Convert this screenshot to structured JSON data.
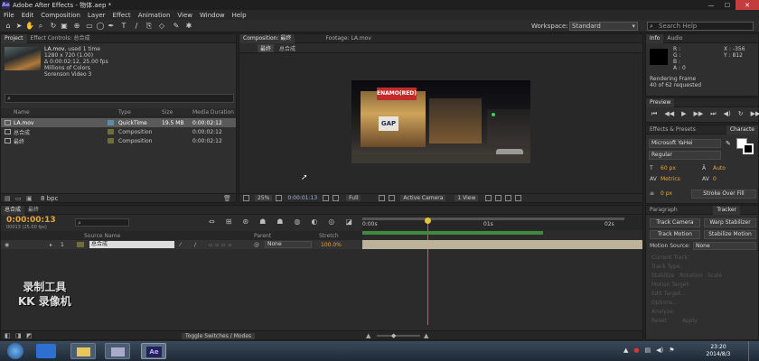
{
  "window": {
    "title": "Adobe After Effects - 物体.aep *",
    "minimize": "—",
    "maximize": "☐",
    "close": "✕"
  },
  "menu": [
    "File",
    "Edit",
    "Composition",
    "Layer",
    "Effect",
    "Animation",
    "View",
    "Window",
    "Help"
  ],
  "toolbar": {
    "workspace_label": "Workspace:",
    "workspace_value": "Standard",
    "search_placeholder": "Search Help"
  },
  "project": {
    "tab": "Project",
    "tab2": "Effect Controls: 总合成",
    "footage_name": "LA.mov",
    "footage_used": ", used 1 time",
    "footage_info": [
      "1280 x 720 (1.00)",
      "Δ 0:00:02:12, 25.00 fps",
      "Millions of Colors",
      "Sorenson Video 3"
    ],
    "columns": [
      "Name",
      "Type",
      "Size",
      "Media Duration"
    ],
    "items": [
      {
        "name": "LA.mov",
        "type": "QuickTime",
        "size": "19.5 MB",
        "duration": "0:00:02:12",
        "color": "#5d8ca8",
        "selected": true
      },
      {
        "name": "总合成",
        "type": "Composition",
        "size": "",
        "duration": "0:00:02:12",
        "color": "#6e6e3a",
        "selected": false
      },
      {
        "name": "最终",
        "type": "Composition",
        "size": "",
        "duration": "0:00:02:12",
        "color": "#6e6e3a",
        "selected": false
      }
    ],
    "bpc": "8 bpc"
  },
  "viewer": {
    "tab": "Composition: 最终",
    "tab2": "Footage: LA.mov",
    "crumbs": [
      "最终",
      "总合成"
    ],
    "zoom": "25%",
    "time": "0:00:01:13",
    "resolution": "Full",
    "camera": "Active Camera",
    "views": "1 View",
    "sign_text": "ENAMO(RED)",
    "store_text": "GAP"
  },
  "info": {
    "tab": "Info",
    "tab2": "Audio",
    "r": "R :",
    "g": "G :",
    "b": "B :",
    "a": "A : 0",
    "x": "X : -356",
    "y": "Y : 812",
    "render1": "Rendering Frame",
    "render2": "40 of 62 requested"
  },
  "preview": {
    "tab": "Preview"
  },
  "effects": {
    "tab": "Effects & Presets",
    "tab2": "Characte"
  },
  "character": {
    "font": "Microsoft YaHei",
    "style": "Regular",
    "size": "60 px",
    "leading": "Auto",
    "kerning": "Metrics",
    "tracking": "0",
    "stroke_size": "0 px",
    "stroke_mode": "Stroke Over Fill"
  },
  "tracker": {
    "tab": "Paragraph",
    "tab2": "Tracker",
    "buttons": [
      "Track Camera",
      "Warp Stabilizer",
      "Track Motion",
      "Stabilize Motion"
    ],
    "source_label": "Motion Source:",
    "source_value": "None",
    "dim": [
      "Current Track:",
      "Track Type:",
      "Stabilize",
      "Rotation",
      "Scale",
      "Motion Target:",
      "Edit Target...",
      "Options...",
      "Analyze:",
      "Reset",
      "Apply"
    ]
  },
  "timeline": {
    "tabs": [
      "总合成",
      "最终"
    ],
    "timecode": "0:00:00:13",
    "fps": "00013 (25.00 fps)",
    "cols": {
      "source": "Source Name",
      "parent": "Parent",
      "stretch": "Stretch"
    },
    "layer": {
      "num": "1",
      "name": "总合成",
      "parent": "None",
      "stretch": "100.0%"
    },
    "ruler": [
      "0:00s",
      "01s",
      "02s"
    ],
    "toggle": "Toggle Switches / Modes"
  },
  "watermark": {
    "line1": "录制工具",
    "line2": "KK 录像机"
  },
  "taskbar": {
    "app": "Ae",
    "time": "23:20",
    "date": "2014/8/3"
  }
}
